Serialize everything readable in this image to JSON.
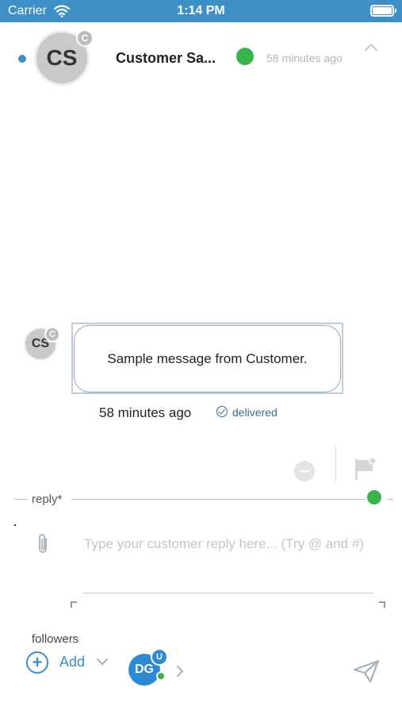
{
  "status_bar": {
    "carrier": "Carrier",
    "time": "1:14 PM"
  },
  "conversation": {
    "contact_initials": "CS",
    "contact_role": "C",
    "contact_name": "Customer Sa...",
    "last_active": "58 minutes ago",
    "presence_color": "#38b34a"
  },
  "message": {
    "sender_initials": "CS",
    "sender_role": "C",
    "text": "Sample message from Customer.",
    "time": "58 minutes ago",
    "status": "delivered"
  },
  "composer": {
    "label": "reply*",
    "placeholder": "Type your customer reply here... (Try @ and #)",
    "value": ""
  },
  "followers": {
    "label": "followers",
    "add_label": "Add",
    "members": [
      {
        "initials": "DG",
        "role": "U"
      }
    ]
  },
  "colors": {
    "accent": "#3d8fc5",
    "online": "#38b34a",
    "delivered": "#3c6d8c"
  },
  "icons": [
    "wifi-icon",
    "battery-icon",
    "collapse-icon",
    "delivered-check-icon",
    "minus-icon",
    "flag-icon",
    "attachment-icon",
    "add-icon",
    "chevron-down-icon",
    "chevron-right-icon",
    "send-icon"
  ]
}
